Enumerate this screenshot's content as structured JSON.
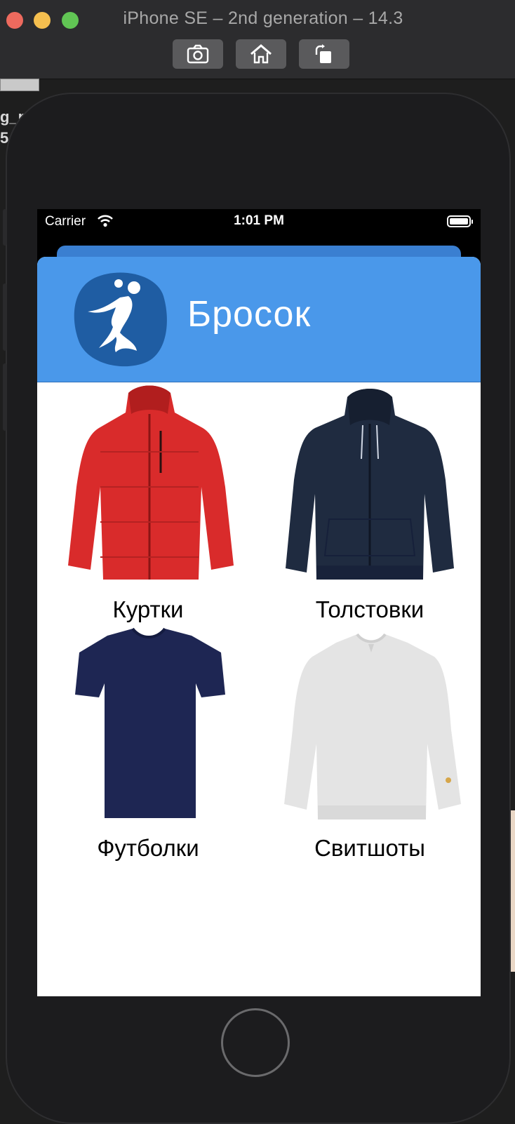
{
  "window": {
    "title": "iPhone SE – 2nd generation – 14.3",
    "toolbar": {
      "screenshot_icon": "camera-icon",
      "home_icon": "home-icon",
      "rotate_icon": "rotate-icon"
    }
  },
  "desktop": {
    "text_lines": [
      "g_p",
      "5"
    ]
  },
  "status_bar": {
    "carrier": "Carrier",
    "time": "1:01 PM",
    "battery_level": 1.0
  },
  "app": {
    "brand_name": "Бросок",
    "header_color": "#4a98ea",
    "categories": [
      {
        "label": "Куртки",
        "image": "red-jacket-image",
        "color": "#d92b2b"
      },
      {
        "label": "Толстовки",
        "image": "navy-hoodie-image",
        "color": "#1f2b40"
      },
      {
        "label": "Футболки",
        "image": "navy-tshirt-image",
        "color": "#1e2653"
      },
      {
        "label": "Свитшоты",
        "image": "grey-sweatshirt-image",
        "color": "#e4e4e4"
      }
    ]
  }
}
